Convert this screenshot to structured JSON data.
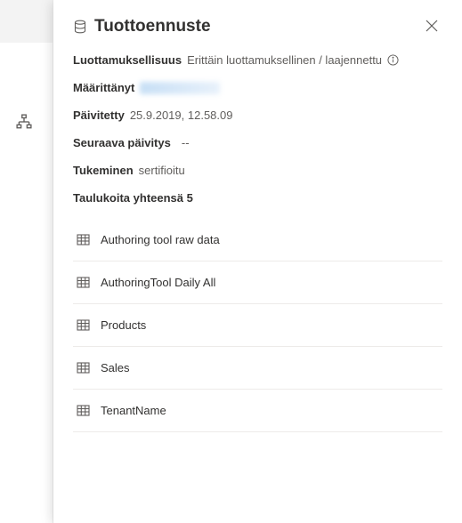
{
  "panel": {
    "title": "Tuottoennuste",
    "sensitivity": {
      "label": "Luottamuksellisuus",
      "value": "Erittäin luottamuksellinen / laajennettu"
    },
    "definedBy": {
      "label": "Määrittänyt"
    },
    "updated": {
      "label": "Päivitetty",
      "value": "25.9.2019, 12.58.09"
    },
    "nextUpdate": {
      "label": "Seuraava päivitys",
      "value": "--"
    },
    "endorsement": {
      "label": "Tukeminen",
      "value": "sertifioitu"
    },
    "tablesTotal": {
      "label": "Taulukoita yhteensä",
      "count": "5"
    },
    "tables": [
      {
        "name": "Authoring tool raw data"
      },
      {
        "name": "AuthoringTool Daily All"
      },
      {
        "name": "Products"
      },
      {
        "name": "Sales"
      },
      {
        "name": "TenantName"
      }
    ]
  }
}
